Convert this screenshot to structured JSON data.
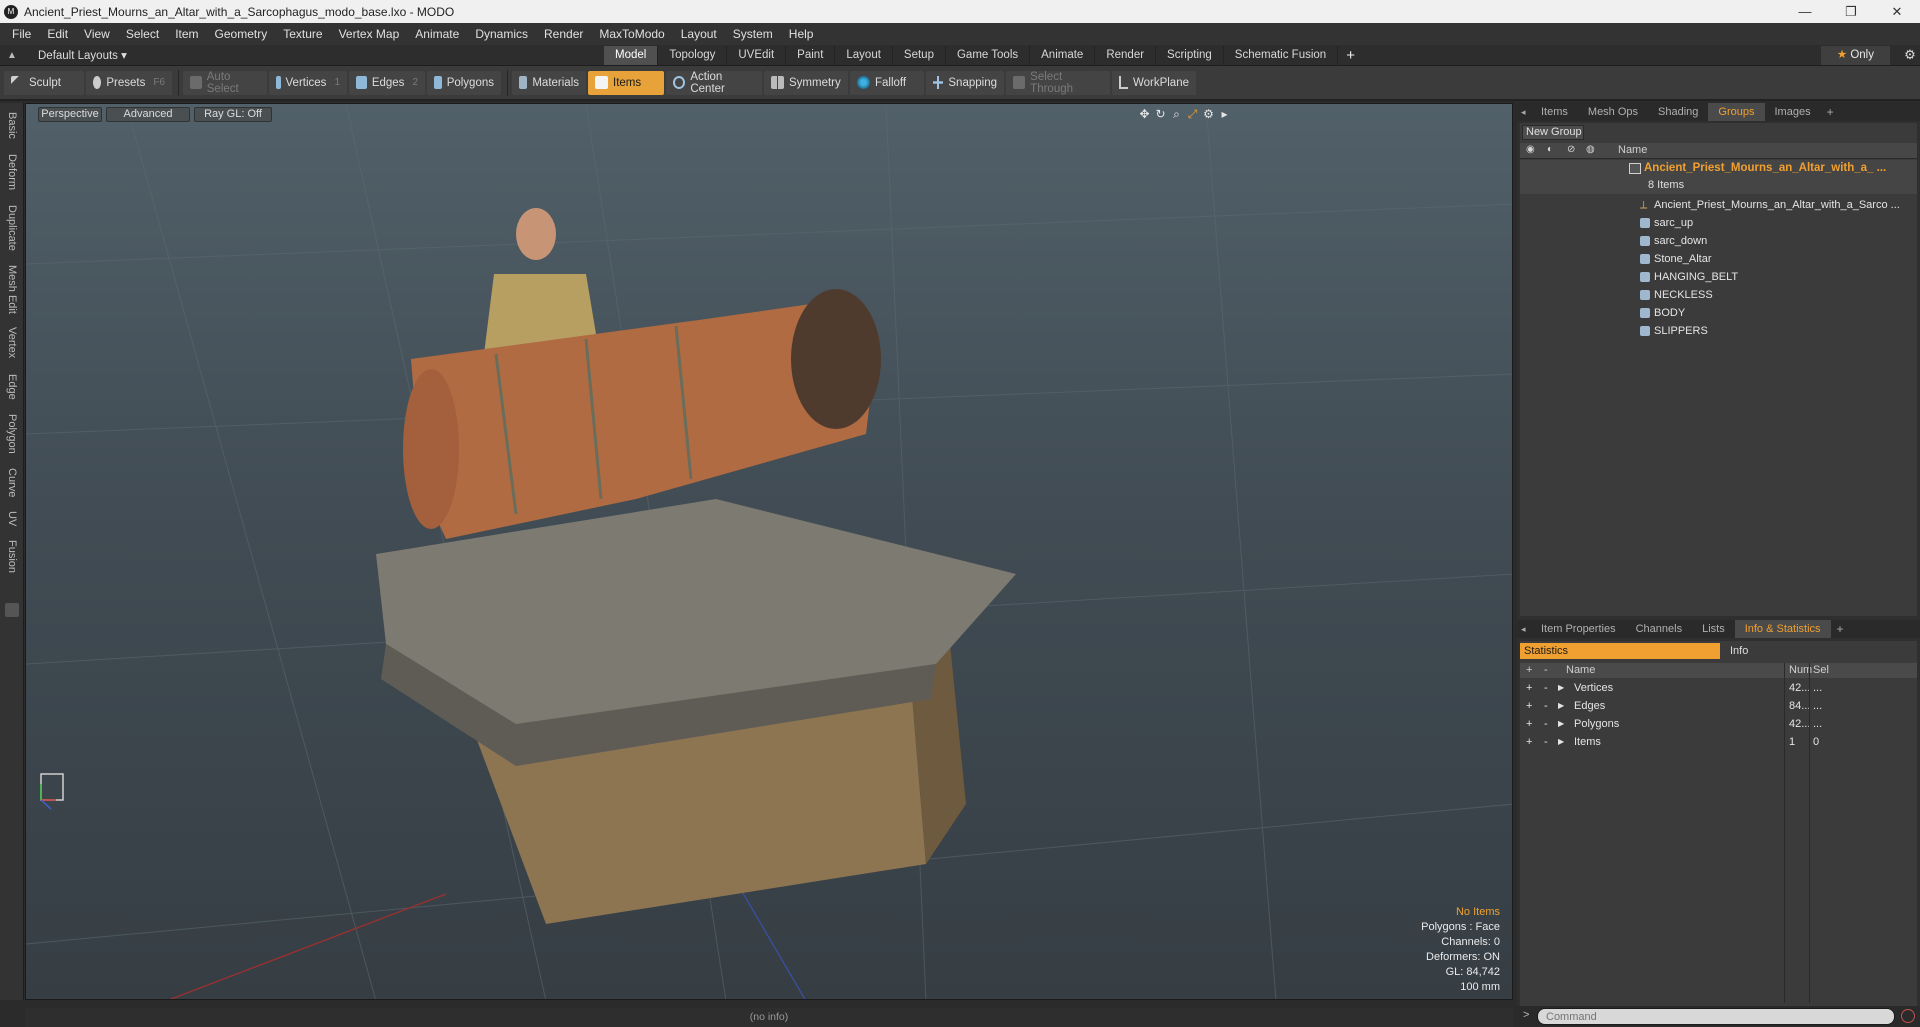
{
  "window": {
    "title": "Ancient_Priest_Mourns_an_Altar_with_a_Sarcophagus_modo_base.lxo - MODO",
    "minimize": "—",
    "maximize": "❐",
    "close": "✕"
  },
  "menu": [
    "File",
    "Edit",
    "View",
    "Select",
    "Item",
    "Geometry",
    "Texture",
    "Vertex Map",
    "Animate",
    "Dynamics",
    "Render",
    "MaxToModo",
    "Layout",
    "System",
    "Help"
  ],
  "layout": {
    "preset": "Default Layouts",
    "tabs": [
      "Model",
      "Topology",
      "UVEdit",
      "Paint",
      "Layout",
      "Setup",
      "Game Tools",
      "Animate",
      "Render",
      "Scripting",
      "Schematic Fusion"
    ],
    "active_tab": "Model",
    "only_label": "Only"
  },
  "toolbar": {
    "sculpt": "Sculpt",
    "presets": "Presets",
    "presets_key": "F6",
    "auto_select": "Auto Select",
    "vertices": "Vertices",
    "vertices_key": "1",
    "edges": "Edges",
    "edges_key": "2",
    "polygons": "Polygons",
    "materials": "Materials",
    "items": "Items",
    "action_center": "Action Center",
    "symmetry": "Symmetry",
    "falloff": "Falloff",
    "snapping": "Snapping",
    "select_through": "Select Through",
    "workplane": "WorkPlane"
  },
  "left_tabs": [
    "Basic",
    "Deform",
    "Duplicate",
    "Mesh Edit",
    "Vertex",
    "Edge",
    "Polygon",
    "Curve",
    "UV",
    "Fusion"
  ],
  "viewport": {
    "view": "Perspective",
    "shading": "Advanced",
    "raygl": "Ray GL: Off",
    "info": {
      "selection": "No Items",
      "polygons": "Polygons : Face",
      "channels": "Channels: 0",
      "deformers": "Deformers: ON",
      "gl": "GL: 84,742",
      "scale": "100 mm"
    }
  },
  "status_text": "(no info)",
  "groups_panel": {
    "tabs": [
      "Items",
      "Mesh Ops",
      "Shading",
      "Groups",
      "Images"
    ],
    "active_tab": "Groups",
    "new_group": "New Group",
    "name_header": "Name",
    "group_name": "Ancient_Priest_Mourns_an_Altar_with_a_ ...",
    "item_count": "8 Items",
    "items": [
      "Ancient_Priest_Mourns_an_Altar_with_a_Sarco ...",
      "sarc_up",
      "sarc_down",
      "Stone_Altar",
      "HANGING_BELT",
      "NECKLESS",
      "BODY",
      "SLIPPERS"
    ]
  },
  "stats_panel": {
    "tabs": [
      "Item Properties",
      "Channels",
      "Lists",
      "Info & Statistics"
    ],
    "active_tab": "Info & Statistics",
    "sub_tabs": [
      "Statistics",
      "Info"
    ],
    "headers": {
      "name": "Name",
      "num": "Num",
      "sel": "Sel"
    },
    "rows": [
      {
        "name": "Vertices",
        "num": "42...",
        "sel": "..."
      },
      {
        "name": "Edges",
        "num": "84...",
        "sel": "..."
      },
      {
        "name": "Polygons",
        "num": "42...",
        "sel": "..."
      },
      {
        "name": "Items",
        "num": "1",
        "sel": "0"
      }
    ]
  },
  "command": {
    "placeholder": "Command"
  },
  "colors": {
    "accent": "#f0a030",
    "active_tool": "#e8a23a"
  }
}
